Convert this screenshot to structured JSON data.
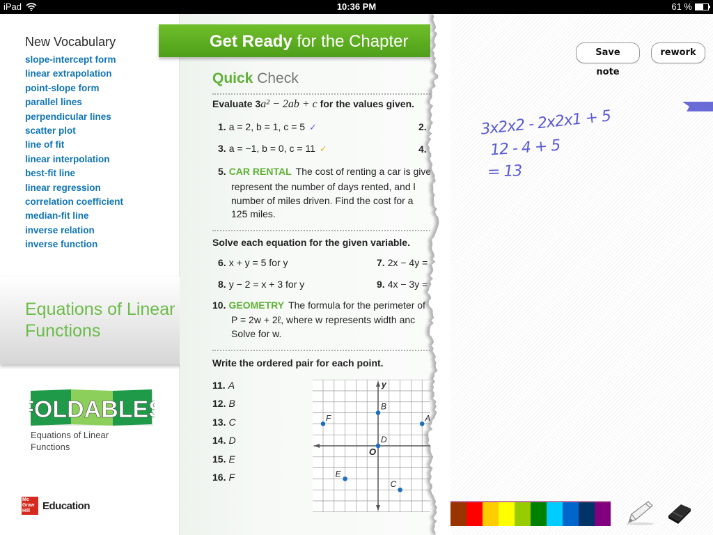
{
  "status_bar": {
    "device": "iPad",
    "time": "10:36 PM",
    "battery": "61 %",
    "battery_level": 0.61
  },
  "sidebar": {
    "vocab_title": "New Vocabulary",
    "vocab": [
      "slope-intercept form",
      "linear extrapolation",
      "point-slope form",
      "parallel lines",
      "perpendicular lines",
      "scatter plot",
      "line of fit",
      "linear interpolation",
      "best-fit line",
      "linear regression",
      "correlation coefficient",
      "median-fit line",
      "inverse relation",
      "inverse function"
    ],
    "chapter_line1": "Equations of Linear",
    "chapter_line2": "Functions",
    "foldables_logo": "FOLDABLES",
    "foldables_desc_line1": "Equations of Linear",
    "foldables_desc_line2": "Functions",
    "publisher_logo": "Mc Graw Hill",
    "publisher_text": "Education"
  },
  "page": {
    "header_bold": "Get Ready",
    "header_rest": " for the Chapter",
    "qc_bold": "Quick",
    "qc_rest": " Check",
    "instr1_pre": "Evaluate 3",
    "instr1_expr": "a² − 2ab + c",
    "instr1_post": " for the values given.",
    "items": [
      {
        "num": "1.",
        "text": "a = 2, b = 1, c = 5",
        "check": "✓",
        "check_color": "#5b5bd6"
      },
      {
        "num": "2.",
        "text": ""
      },
      {
        "num": "3.",
        "text": "a = −1, b = 0, c = 11",
        "check": "✓",
        "check_color": "#e8b51c"
      },
      {
        "num": "4.",
        "text": ""
      }
    ],
    "q5": {
      "num": "5.",
      "keyword": "CAR RENTAL",
      "line1": "The cost of renting a car is give",
      "line2": "represent the number of days rented, and l",
      "line3": "number of miles driven. Find the cost for a",
      "line4": "125 miles."
    },
    "instr2": "Solve each equation for the given variable.",
    "solve_items": [
      {
        "num": "6.",
        "text": "x + y = 5 for y"
      },
      {
        "num": "7.",
        "text": "2x − 4y ="
      },
      {
        "num": "8.",
        "text": "y − 2 = x + 3 for y"
      },
      {
        "num": "9.",
        "text": "4x − 3y ="
      }
    ],
    "q10": {
      "num": "10.",
      "keyword": "GEOMETRY",
      "line1": "The formula for the perimeter of",
      "line2": "P = 2w + 2ℓ, where w represents width anc",
      "line3": "Solve for w."
    },
    "instr3": "Write the ordered pair for each point.",
    "point_items": [
      {
        "num": "11.",
        "text": "A"
      },
      {
        "num": "12.",
        "text": "B"
      },
      {
        "num": "13.",
        "text": "C"
      },
      {
        "num": "14.",
        "text": "D"
      },
      {
        "num": "15.",
        "text": "E"
      },
      {
        "num": "16.",
        "text": "F"
      }
    ],
    "graph": {
      "x_label": "",
      "y_label": "y",
      "origin_label": "O",
      "points": [
        {
          "label": "A",
          "x": 4,
          "y": 2
        },
        {
          "label": "B",
          "x": 0,
          "y": 3
        },
        {
          "label": "C",
          "x": 2,
          "y": -4
        },
        {
          "label": "D",
          "x": 0,
          "y": 0
        },
        {
          "label": "E",
          "x": -3,
          "y": -3
        },
        {
          "label": "F",
          "x": -5,
          "y": 2
        }
      ]
    }
  },
  "note": {
    "save_label": "Save note",
    "rework_label": "rework",
    "ink_color": "#5b5bd6",
    "lines": [
      "3x2x2 - 2x2x1  + 5",
      "12 - 4 + 5",
      "= 13"
    ],
    "palette": [
      "#993300",
      "#ff0000",
      "#ffcc00",
      "#ffff00",
      "#99cc00",
      "#008000",
      "#00ccff",
      "#0066cc",
      "#003366",
      "#800080"
    ],
    "tools": [
      "pencil",
      "eraser"
    ]
  }
}
